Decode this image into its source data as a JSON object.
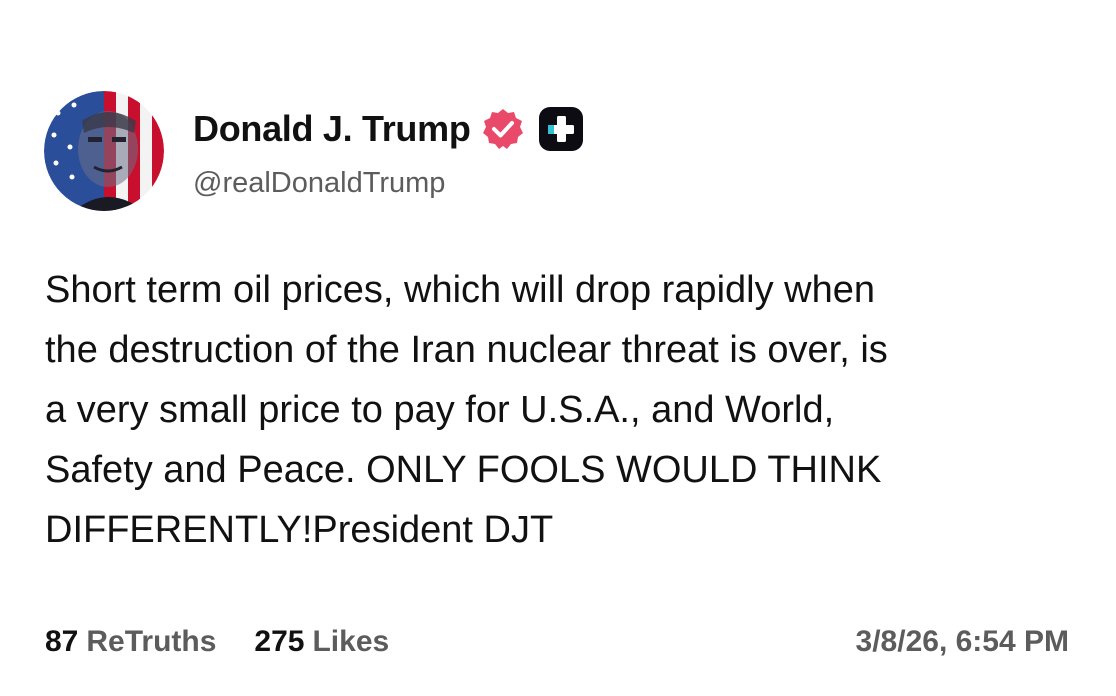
{
  "author": {
    "display_name": "Donald J. Trump",
    "handle": "@realDonaldTrump",
    "avatar_icon": "flag-portrait-avatar",
    "verified_icon": "verified-badge-icon",
    "plus_icon": "truth-plus-icon",
    "verified_color": "#e94a6a"
  },
  "post": {
    "lines": [
      "Short term oil prices, which will drop rapidly when",
      "the destruction of the Iran nuclear threat is over, is",
      "a very small price to pay for U.S.A., and World,",
      "Safety and Peace. ONLY FOOLS WOULD THINK",
      "DIFFERENTLY!President DJT"
    ]
  },
  "stats": {
    "retruths_count": "87",
    "retruths_label": "ReTruths",
    "likes_count": "275",
    "likes_label": "Likes"
  },
  "timestamp": "3/8/26, 6:54 PM"
}
